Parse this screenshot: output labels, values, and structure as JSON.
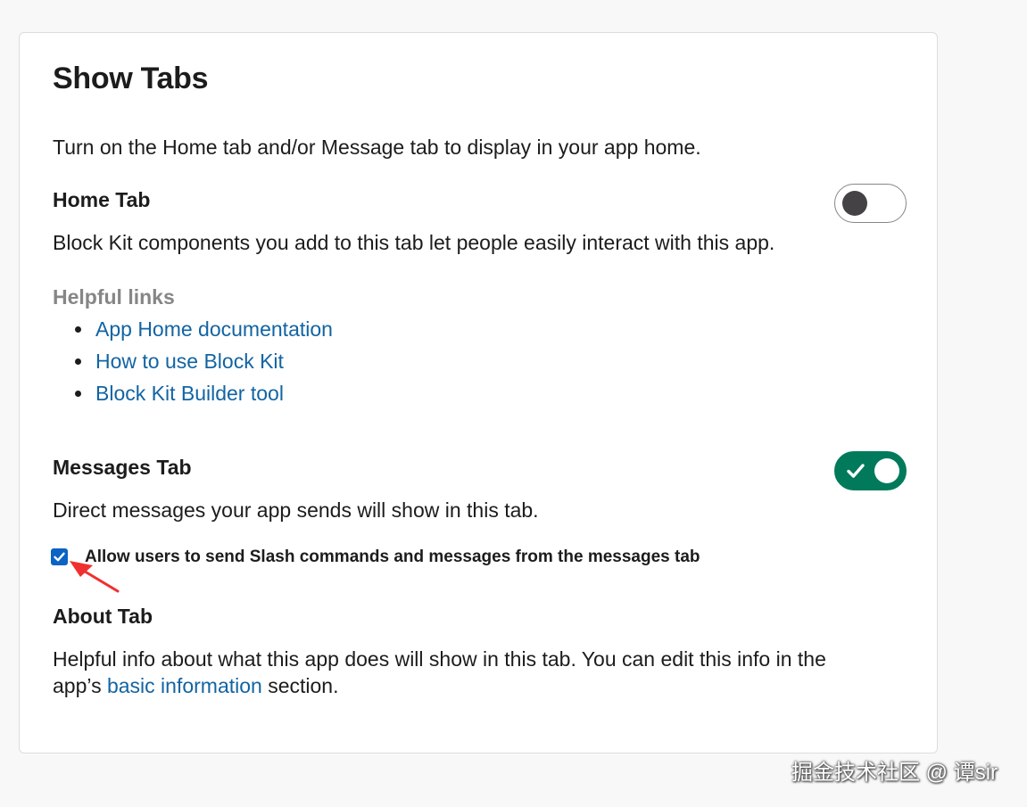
{
  "card": {
    "title": "Show Tabs",
    "intro": "Turn on the Home tab and/or Message tab to display in your app home."
  },
  "home_tab": {
    "title": "Home Tab",
    "toggle_state": "off",
    "description": "Block Kit components you add to this tab let people easily interact with this app.",
    "helpful_links_label": "Helpful links",
    "links": [
      "App Home documentation",
      "How to use Block Kit",
      "Block Kit Builder tool"
    ]
  },
  "messages_tab": {
    "title": "Messages Tab",
    "toggle_state": "on",
    "description": "Direct messages your app sends will show in this tab.",
    "checkbox": {
      "checked": true,
      "label": "Allow users to send Slash commands and messages from the messages tab"
    }
  },
  "about_tab": {
    "title": "About Tab",
    "description_before": "Helpful info about what this app does will show in this tab. You can edit this info in the",
    "description_line2_before": "app’s ",
    "link_text": "basic information",
    "description_after": " section."
  },
  "watermark": "掘金技术社区 @ 谭sir",
  "colors": {
    "toggle_on": "#007a5a",
    "link": "#1264a3",
    "checkbox": "#0b63c4",
    "annotation_arrow": "#f03030"
  },
  "icons": {
    "toggle_check": "checkmark-icon",
    "annotation": "red-arrow-icon"
  }
}
